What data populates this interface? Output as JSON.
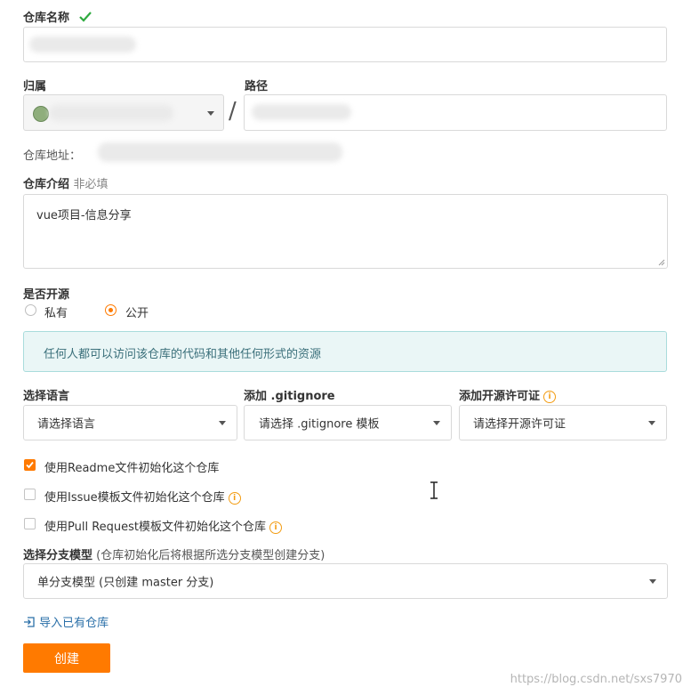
{
  "repo_name": {
    "label": "仓库名称",
    "check_icon": "checkmark-icon"
  },
  "owner": {
    "label": "归属",
    "separator": "/"
  },
  "path": {
    "label": "路径"
  },
  "repo_address": {
    "label": "仓库地址："
  },
  "intro": {
    "label": "仓库介绍",
    "optional": "非必填",
    "value": "vue项目-信息分享"
  },
  "open_source": {
    "label": "是否开源",
    "options": [
      {
        "label": "私有",
        "selected": false
      },
      {
        "label": "公开",
        "selected": true
      }
    ],
    "notice": "任何人都可以访问该仓库的代码和其他任何形式的资源"
  },
  "language": {
    "label": "选择语言",
    "value": "请选择语言"
  },
  "gitignore": {
    "label": "添加 .gitignore",
    "value": "请选择 .gitignore 模板"
  },
  "license": {
    "label": "添加开源许可证",
    "value": "请选择开源许可证"
  },
  "init_options": [
    {
      "label": "使用Readme文件初始化这个仓库",
      "checked": true,
      "info": false
    },
    {
      "label": "使用Issue模板文件初始化这个仓库",
      "checked": false,
      "info": true
    },
    {
      "label": "使用Pull Request模板文件初始化这个仓库",
      "checked": false,
      "info": true
    }
  ],
  "branch": {
    "label": "选择分支模型",
    "hint": "(仓库初始化后将根据所选分支模型创建分支)",
    "value": "单分支模型 (只创建 master 分支)"
  },
  "import_link": "导入已有仓库",
  "create_button": "创建",
  "watermark": "https://blog.csdn.net/sxs7970",
  "colors": {
    "accent": "#ff7a00",
    "check": "#2eaa3f",
    "notice_bg": "#eaf6f6",
    "notice_border": "#a9dcdc",
    "link": "#2a6fa8"
  }
}
